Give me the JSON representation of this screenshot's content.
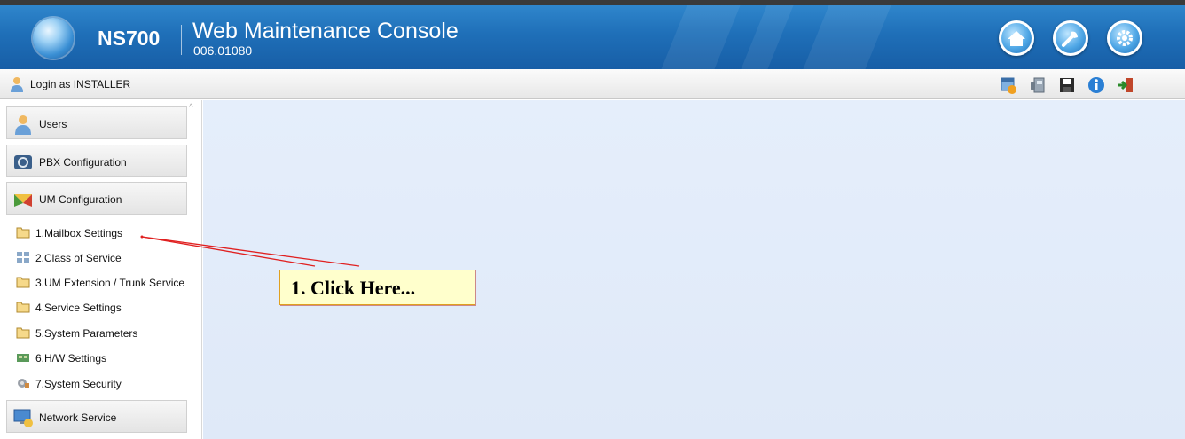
{
  "header": {
    "brand": "NS700",
    "title": "Web Maintenance Console",
    "version": "006.01080",
    "buttons": [
      {
        "icon": "home-icon"
      },
      {
        "icon": "tool-icon"
      },
      {
        "icon": "settings-gear-icon"
      }
    ]
  },
  "login": {
    "text": "Login as INSTALLER",
    "toolbar_icons": [
      "calendar-alert-icon",
      "phone-icon",
      "save-icon",
      "info-icon",
      "logout-icon"
    ]
  },
  "sidebar": {
    "sections": [
      {
        "label": "Users",
        "icon": "users-icon"
      },
      {
        "label": "PBX Configuration",
        "icon": "pbx-configuration-icon"
      },
      {
        "label": "UM Configuration",
        "icon": "um-configuration-icon"
      },
      {
        "label": "Network Service",
        "icon": "network-service-icon"
      }
    ],
    "items": [
      {
        "label": "1.Mailbox Settings",
        "icon": "folder-icon"
      },
      {
        "label": "2.Class of Service",
        "icon": "grid-icon"
      },
      {
        "label": "3.UM Extension / Trunk Service",
        "icon": "folder-icon"
      },
      {
        "label": "4.Service Settings",
        "icon": "folder-icon"
      },
      {
        "label": "5.System Parameters",
        "icon": "folder-icon"
      },
      {
        "label": "6.H/W Settings",
        "icon": "hardware-icon"
      },
      {
        "label": "7.System Security",
        "icon": "security-icon"
      }
    ]
  },
  "annotation": {
    "text": "1. Click Here..."
  },
  "colors": {
    "header_blue": "#1f6fb8",
    "main_bg": "#e3ecfa",
    "callout_bg": "#ffffcc",
    "arrow_red": "#e02020"
  }
}
